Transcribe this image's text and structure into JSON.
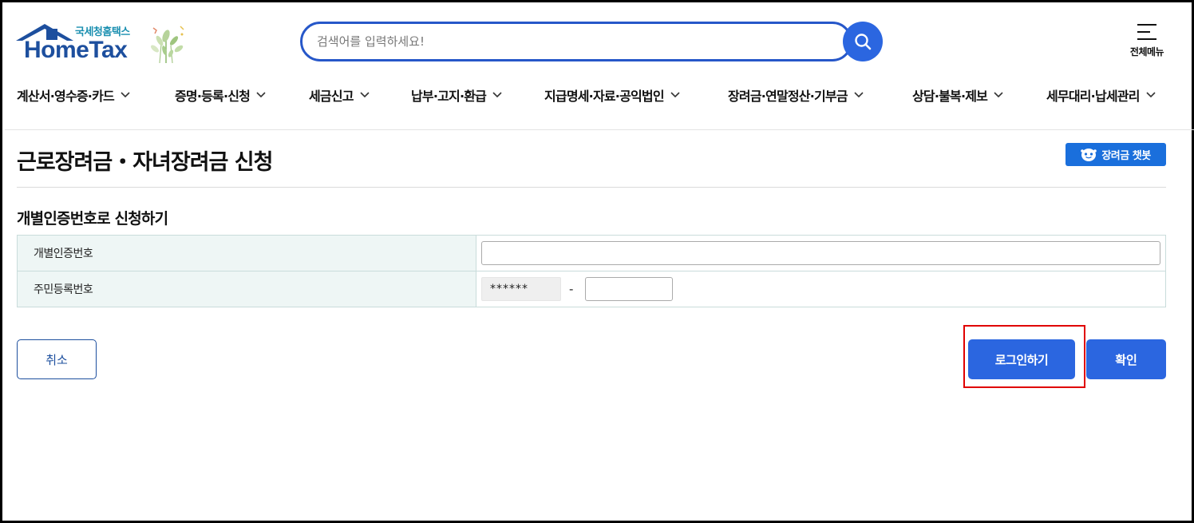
{
  "header": {
    "logo_sub": "국세청홈택스",
    "logo_main": "HomeTax",
    "search_placeholder": "검색어를 입력하세요!",
    "menu_label": "전체메뉴"
  },
  "nav": {
    "items": [
      "계산서·영수증·카드",
      "증명·등록·신청",
      "세금신고",
      "납부·고지·환급",
      "지급명세·자료·공익법인",
      "장려금·연말정산·기부금",
      "상담·불복·제보",
      "세무대리·납세관리"
    ]
  },
  "page": {
    "title": "근로장려금・자녀장려금 신청",
    "chatbot_label": "장려금 챗봇",
    "section_title": "개별인증번호로 신청하기"
  },
  "form": {
    "row1_label": "개별인증번호",
    "row2_label": "주민등록번호",
    "rrn_front_masked": "******",
    "separator": "-"
  },
  "buttons": {
    "cancel": "취소",
    "login": "로그인하기",
    "confirm": "확인"
  },
  "colors": {
    "brand_blue": "#2b66e0",
    "logo_blue": "#1d4f9e",
    "table_header_bg": "#eef6f5",
    "highlight": "#e00000"
  }
}
